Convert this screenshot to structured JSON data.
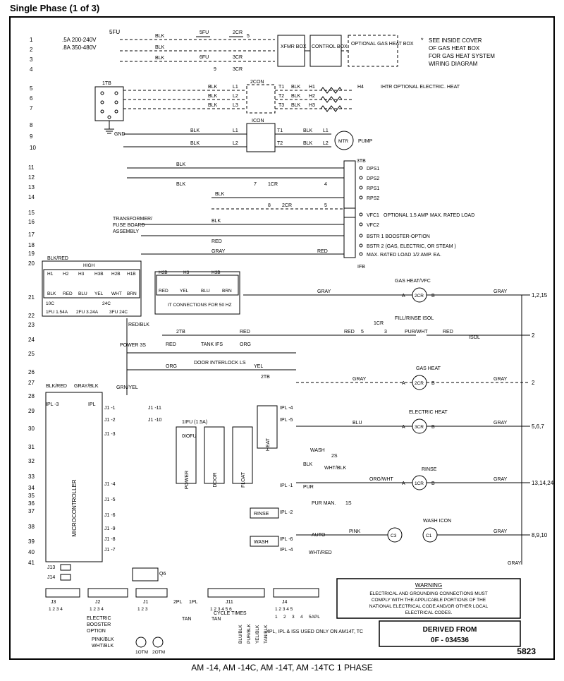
{
  "title": "Single Phase (1 of 3)",
  "footer": "AM -14, AM -14C, AM -14T, AM -14TC 1 PHASE",
  "page_id": "5823",
  "derived_from": {
    "label": "DERIVED FROM",
    "value": "0F - 034536"
  },
  "warning": {
    "heading": "WARNING",
    "text1": "ELECTRICAL AND GROUNDING CONNECTIONS MUST",
    "text2": "COMPLY WITH THE APPLICABLE PORTIONS OF THE",
    "text3": "NATIONAL ELECTRICAL CODE AND/OR OTHER LOCAL",
    "text4": "ELECTRICAL CODES."
  },
  "note": {
    "star": "*",
    "l1": "SEE INSIDE COVER",
    "l2": "OF GAS HEAT BOX",
    "l3": "FOR GAS HEAT SYSTEM",
    "l4": "WIRING DIAGRAM"
  },
  "left_rows": [
    "1",
    "2",
    "3",
    "4",
    "5",
    "6",
    "7",
    "8",
    "9",
    "10",
    "11",
    "12",
    "13",
    "14",
    "15",
    "16",
    "17",
    "18",
    "19",
    "20",
    "21",
    "22",
    "23",
    "24",
    "25",
    "26",
    "27",
    "28",
    "29",
    "30",
    "31",
    "32",
    "33",
    "34",
    "35",
    "36",
    "37",
    "38",
    "39",
    "40",
    "41"
  ],
  "right_refs": [
    "1,2,15",
    "5,6,7",
    "13,14,24",
    "8,9,10"
  ],
  "header_ratings": {
    "fu5": "5FU",
    "amp5": ".5A 200-240V",
    "amp8": ".8A 350-480V"
  },
  "components": {
    "xfmr": "XFMR BOX",
    "control": "CONTROL BOX",
    "optional_gas": "OPTIONAL GAS HEAT BOX",
    "itb": "1TB",
    "gnd": "GND",
    "transformer_assy1": "TRANSFORMER/",
    "transformer_assy2": "FUSE BOARD",
    "transformer_assy3": "ASSEMBLY",
    "high": "HIGH",
    "hlabels": [
      "H1",
      "H2",
      "H3",
      "H3B",
      "H2B",
      "H1B"
    ],
    "translabels": [
      "BLK",
      "RED",
      "BLU",
      "YEL",
      "WHT",
      "BRN",
      "RED",
      "YEL",
      "BLU",
      "BRN"
    ],
    "fuses": [
      "1FU 1.54A",
      "2FU 3.24A",
      "3FU 24C"
    ],
    "it_conn": "IT CONNECTIONS FOR 50 HZ",
    "mtr": "MTR",
    "pump": "PUMP",
    "dps": [
      "DPS1",
      "DPS2",
      "RPS1",
      "RPS2"
    ],
    "vfc": [
      "VFC1",
      "VFC2"
    ],
    "vfc_note": "OPTIONAL 1.5 AMP",
    "vfc_max": "MAX. RATED LOAD",
    "bstr1": "BSTR 1 BOOSTER-OPTION",
    "bstr2": "BSTR 2 (GAS, ELECTRIC, OR STEAM )",
    "bstr3": "MAX. RATED LOAD 1/2 AMP. EA.",
    "gasheat_vfc": "GAS HEAT/VFC",
    "fillrinse": "FILL/RINSE ISOL",
    "relays": {
      "2cr": "2CR",
      "3cr": "3CR",
      "1cr": "1CR",
      "c3": "C3",
      "c1": "C1"
    },
    "gasheat": "GAS HEAT",
    "elecheat": "ELECTRIC HEAT",
    "rinse": "RINSE",
    "wash": "WASH ICON",
    "mcu": "MICROCONTROLLER",
    "ipl": "IPL",
    "iifu": "1IFU (1.5A)",
    "iofu": "0IOFU",
    "power": "POWER",
    "door": "DOOR",
    "float": "FLOAT",
    "heat": "HEAT",
    "power_3s": "POWER 3S",
    "tank_ifs": "TANK IFS",
    "door_interlock": "DOOR INTERLOCK LS",
    "rinse_lbl": "RINSE",
    "wash_lbl": "WASH",
    "man_2s": "2S",
    "man": "PUR MAN.",
    "auto_1s": "1S",
    "booster_opt1": "ELECTRIC",
    "booster_opt2": "BOOSTER",
    "booster_opt3": "OPTION",
    "cycle_times": "CYCLE TIMES",
    "usednote": "4PL, IPL & ISS USED ONLY ON AM14T, TC",
    "timers": [
      "1OTM",
      "2OTM"
    ],
    "conns": {
      "j1": "J1",
      "j2": "J2",
      "j3": "J3",
      "j4": "J4",
      "j11": "J11",
      "j13": "J13",
      "j14": "J14"
    },
    "j1terms": "1 2 3",
    "j2terms": "1 2 3 4",
    "j3terms": "1 2 3 4",
    "j11terms": "1 2 3 4 5 6",
    "j4terms": "1 2 3 4 5",
    "sapl": [
      "1",
      "2",
      "3",
      "4",
      "5APL"
    ],
    "twocon": "2CON",
    "icon": "ICON",
    "ihtr": "IHTR OPTIONAL ELECTRIC. HEAT"
  },
  "wire_colors": {
    "blk": "BLK",
    "red": "RED",
    "gray": "GRAY",
    "yel": "YEL",
    "org": "ORG",
    "pink": "PINK",
    "wht": "WHT",
    "tan": "TAN",
    "blu": "BLU",
    "pur": "PUR",
    "orgwht": "ORG/WHT",
    "purwht": "PUR/WHT",
    "whtred": "WHT/RED",
    "blkred": "BLK/RED",
    "grayblk": "GRAY/BLK",
    "grnyel": "GRN/YEL",
    "redblk": "RED/BLK",
    "pinkblk": "PINK/BLK",
    "whtblk": "WHT/BLK",
    "blublk": "BLU/BLK",
    "purblk": "PUR/BLK",
    "yelblk": "YEL/BLK",
    "tanblk": "TAN/BLK",
    "wht_blk": "WHT/BLK"
  },
  "wire_tags": {
    "fu5": "5FU",
    "fu6": "6FU",
    "cr3": "3CR",
    "cr2": "2CR",
    "cr5": "5",
    "cr9": "9",
    "l1": "L1",
    "l2": "L2",
    "l3": "L3",
    "t1": "T1",
    "t2": "T2",
    "t3": "T3",
    "h1": "H1",
    "h2": "H2",
    "h3": "H3",
    "h4": "H4",
    "twotb": "2TB",
    "threetb": "3TB",
    "ifb": "IFB",
    "sevencr": "7",
    "eightcr": "8",
    "cr1": "1CR",
    "cr4": "4",
    "icr_3": "3",
    "icr_5": "5"
  },
  "ipl_lbls": [
    "IPL -1",
    "IPL -2",
    "IPL -3",
    "IPL -4",
    "IPL -5",
    "IPL -6"
  ],
  "j1_lbls": [
    "J1 -1",
    "J1 -2",
    "J1 -11",
    "J1 -10",
    "J1 -3",
    "J1 -4",
    "J1 -5",
    "J1 -6",
    "J1 -9",
    "J1 -8",
    "J1 -7"
  ],
  "terminals": [
    "A",
    "B",
    "A",
    "B",
    "A",
    "B",
    "A",
    "B"
  ],
  "q6": "Q6",
  "pl2": "2PL",
  "pla": "1PL"
}
